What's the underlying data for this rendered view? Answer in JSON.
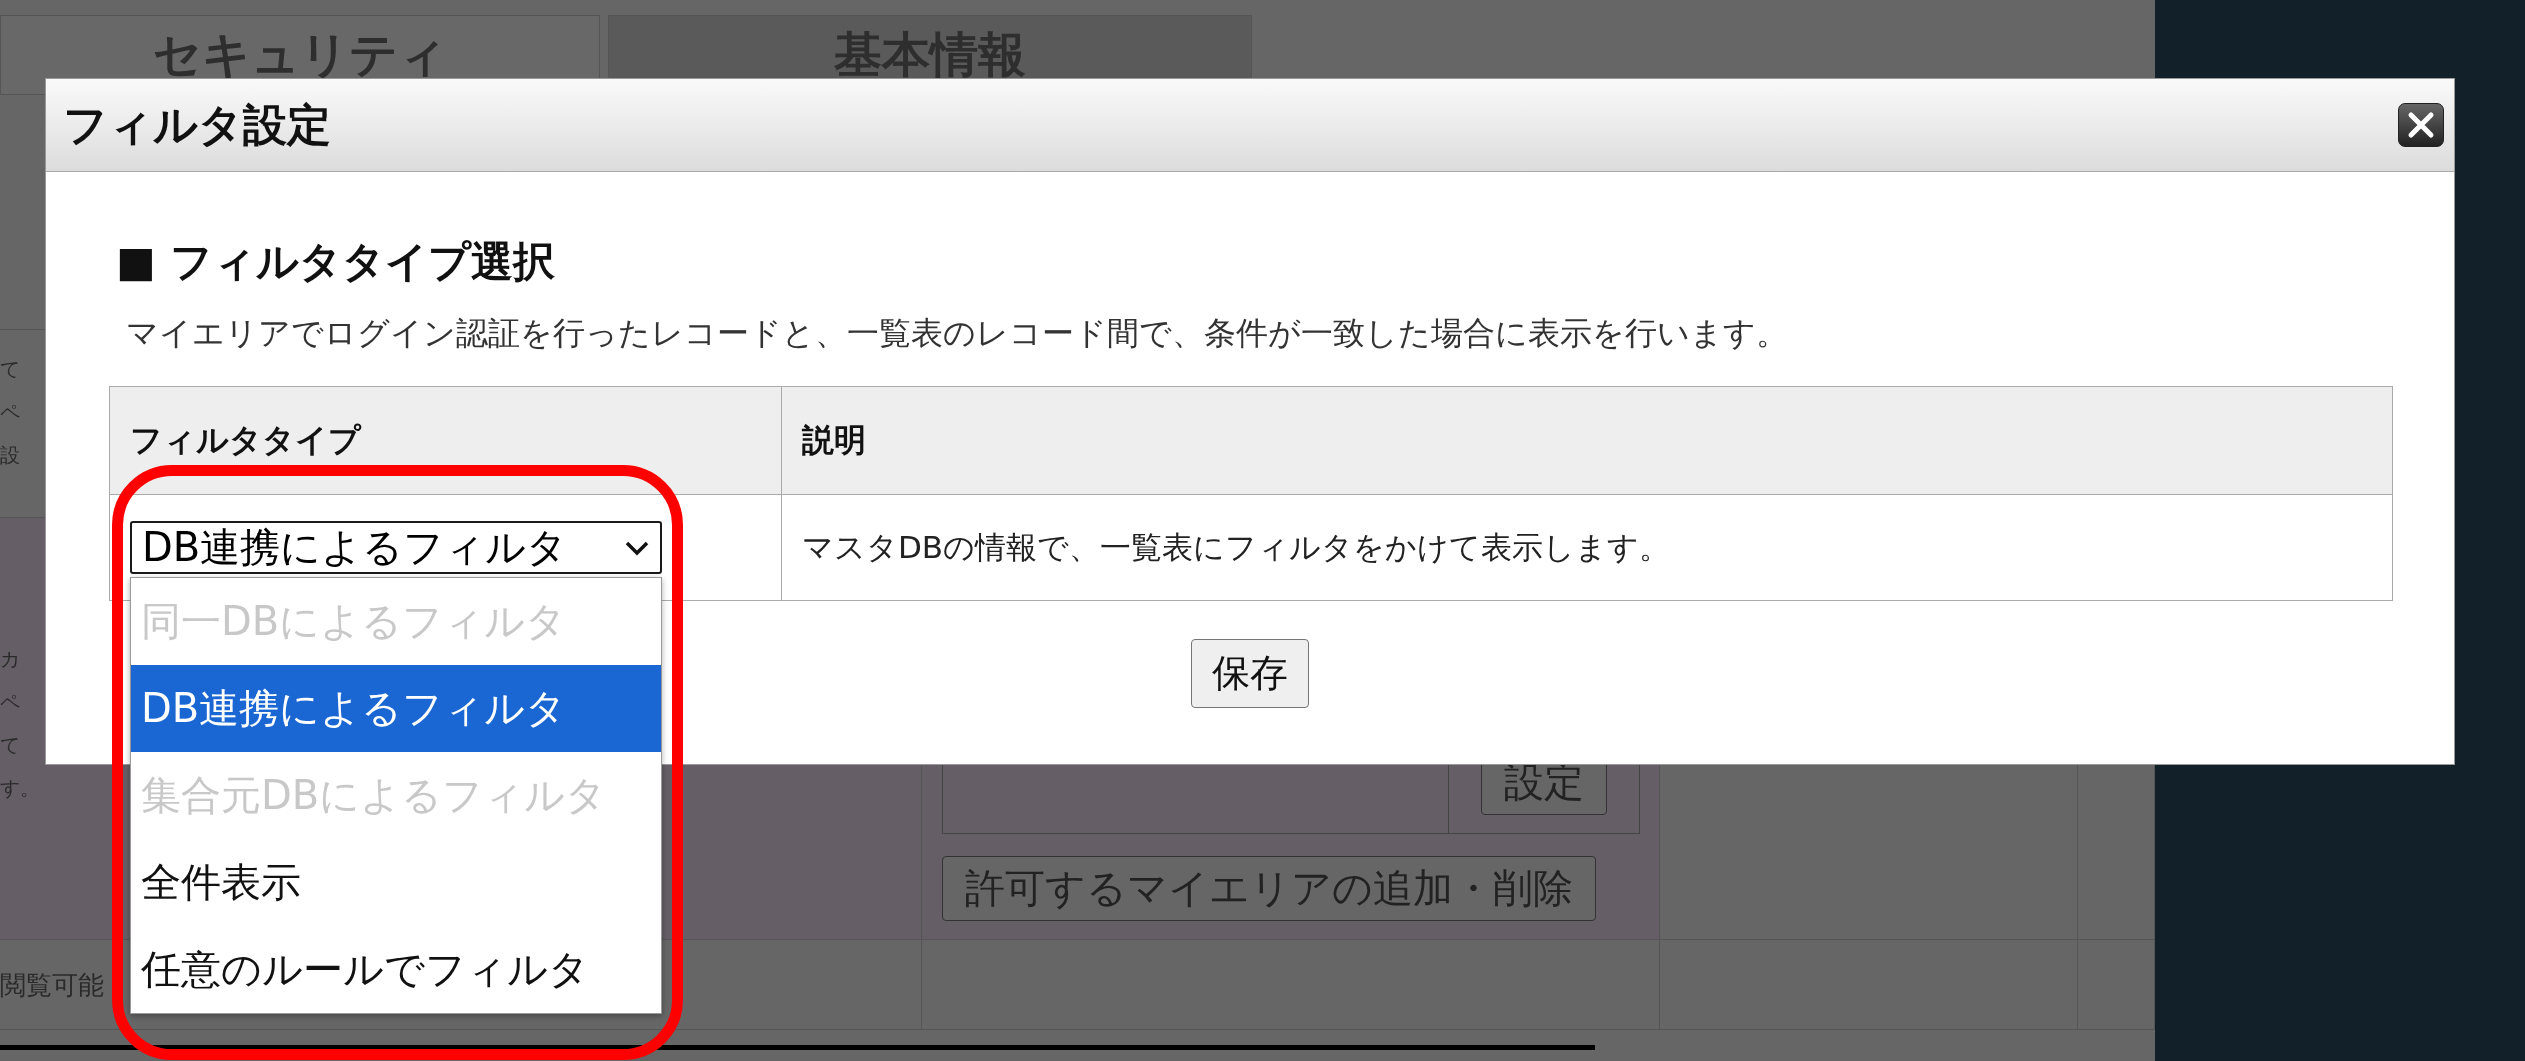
{
  "background_page": {
    "tabs": [
      {
        "label": "セキュリティ",
        "selected": true
      },
      {
        "label": "基本情報",
        "selected": false
      }
    ],
    "upper_fragments": [
      "て",
      "ペ",
      "設"
    ],
    "lower_fragments": [
      "カ",
      "ペ",
      "て",
      "す。"
    ],
    "row_label": "閲覧可能",
    "set_button": "設定",
    "mydomain_button": "許可するマイエリアの追加・削除"
  },
  "dialog": {
    "title": "フィルタ設定",
    "section_heading": "■ フィルタタイプ選択",
    "description": "マイエリアでログイン認証を行ったレコードと、一覧表のレコード間で、条件が一致した場合に表示を行います。",
    "table": {
      "columns": [
        "フィルタタイプ",
        "説明"
      ],
      "rows": [
        {
          "filter_type": {
            "value": "DB連携によるフィルタ",
            "expanded": true,
            "options": [
              {
                "label": "同一DBによるフィルタ",
                "selected": false,
                "disabled": true
              },
              {
                "label": "DB連携によるフィルタ",
                "selected": true,
                "disabled": false
              },
              {
                "label": "集合元DBによるフィルタ",
                "selected": false,
                "disabled": true
              },
              {
                "label": "全件表示",
                "selected": false,
                "disabled": false
              },
              {
                "label": "任意のルールでフィルタ",
                "selected": false,
                "disabled": false
              }
            ]
          },
          "description": "マスタDBの情報で、一覧表にフィルタをかけて表示します。"
        }
      ]
    },
    "save_button": "保存"
  }
}
